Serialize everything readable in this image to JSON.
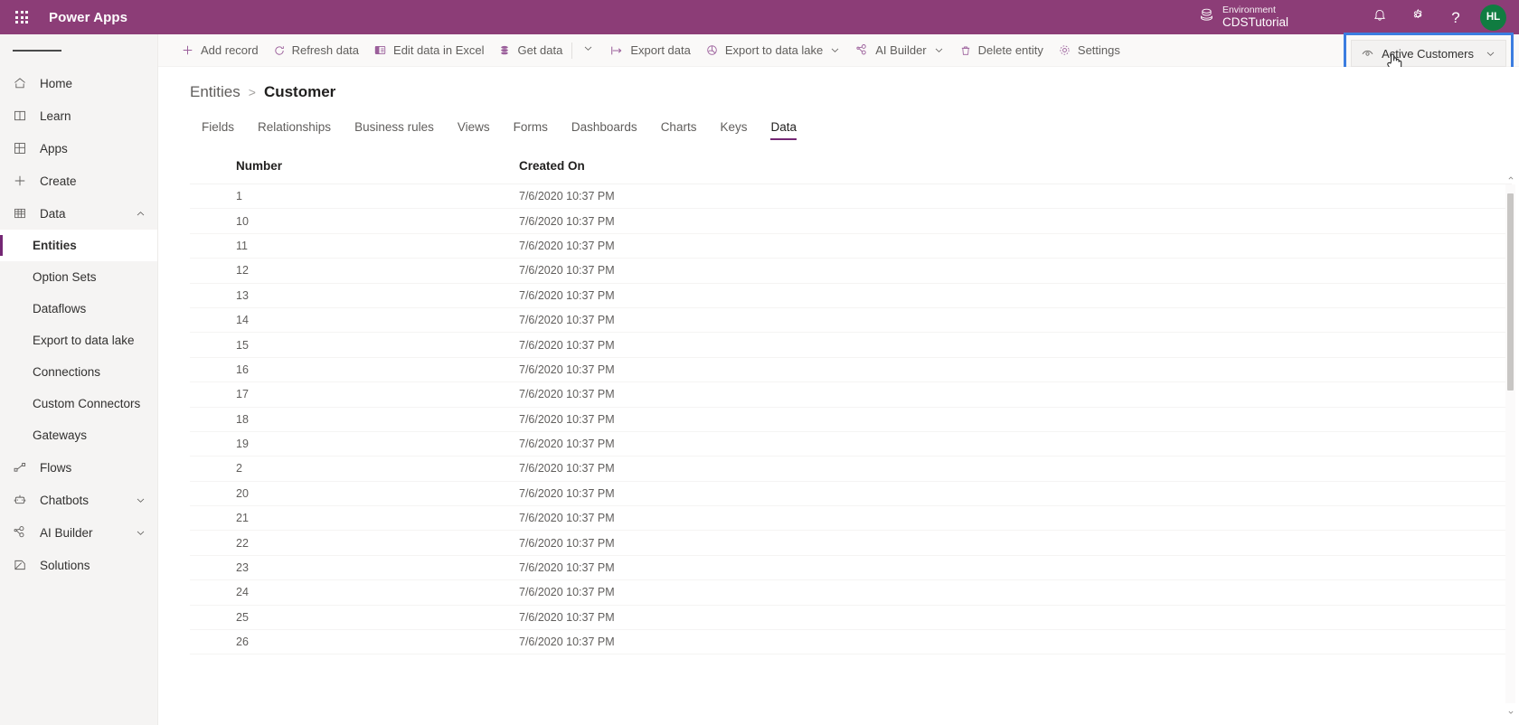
{
  "suitebar": {
    "waffle_label": "App launcher",
    "brand": "Power Apps",
    "environment_label": "Environment",
    "environment_name": "CDSTutorial",
    "notifications_label": "Notifications",
    "settings_label": "Settings",
    "help_label": "?",
    "avatar_initials": "HL",
    "avatar_color": "#107C41",
    "brand_color": "#8C3D77"
  },
  "sidebar": {
    "items": [
      {
        "label": "Home",
        "icon": "home-icon",
        "type": "top"
      },
      {
        "label": "Learn",
        "icon": "book-icon",
        "type": "top"
      },
      {
        "label": "Apps",
        "icon": "apps-grid-icon",
        "type": "top"
      },
      {
        "label": "Create",
        "icon": "plus-icon",
        "type": "top"
      },
      {
        "label": "Data",
        "icon": "table-icon",
        "type": "top",
        "expanded": true,
        "chevron": "chevron-up-icon"
      },
      {
        "label": "Entities",
        "type": "sub",
        "selected": true
      },
      {
        "label": "Option Sets",
        "type": "sub"
      },
      {
        "label": "Dataflows",
        "type": "sub"
      },
      {
        "label": "Export to data lake",
        "type": "sub"
      },
      {
        "label": "Connections",
        "type": "sub"
      },
      {
        "label": "Custom Connectors",
        "type": "sub"
      },
      {
        "label": "Gateways",
        "type": "sub"
      },
      {
        "label": "Flows",
        "icon": "flow-icon",
        "type": "top"
      },
      {
        "label": "Chatbots",
        "icon": "bot-icon",
        "type": "top",
        "chevron": "chevron-down-icon"
      },
      {
        "label": "AI Builder",
        "icon": "ai-builder-icon",
        "type": "top",
        "chevron": "chevron-down-icon"
      },
      {
        "label": "Solutions",
        "icon": "solutions-icon",
        "type": "top"
      }
    ]
  },
  "commandbar": {
    "items": [
      {
        "label": "Add record",
        "icon": "plus-icon"
      },
      {
        "label": "Refresh data",
        "icon": "refresh-icon"
      },
      {
        "label": "Edit data in Excel",
        "icon": "excel-icon"
      },
      {
        "label": "Get data",
        "icon": "database-icon"
      },
      {
        "label": "Export data",
        "icon": "export-arrow-icon"
      },
      {
        "label": "Export to data lake",
        "icon": "data-lake-icon",
        "chevron": "chevron-down-icon"
      },
      {
        "label": "AI Builder",
        "icon": "ai-builder-icon",
        "chevron": "chevron-down-icon"
      },
      {
        "label": "Delete entity",
        "icon": "trash-icon"
      },
      {
        "label": "Settings",
        "icon": "gear-icon"
      }
    ],
    "get_data_caret": "chevron-down-icon",
    "view_selector": {
      "label": "Active Customers",
      "icon": "view-eye-icon",
      "chevron": "chevron-down-icon",
      "highlight_color": "#3B7DE0",
      "highlighted": true,
      "cursor": "pointing-hand-cursor"
    }
  },
  "breadcrumb": {
    "parent": "Entities",
    "separator": ">",
    "current": "Customer"
  },
  "tabs": [
    {
      "label": "Fields",
      "active": false
    },
    {
      "label": "Relationships",
      "active": false
    },
    {
      "label": "Business rules",
      "active": false
    },
    {
      "label": "Views",
      "active": false
    },
    {
      "label": "Forms",
      "active": false
    },
    {
      "label": "Dashboards",
      "active": false
    },
    {
      "label": "Charts",
      "active": false
    },
    {
      "label": "Keys",
      "active": false
    },
    {
      "label": "Data",
      "active": true
    }
  ],
  "grid": {
    "columns": [
      "Number",
      "Created On"
    ],
    "rows": [
      {
        "number": "1",
        "created_on": "7/6/2020 10:37 PM"
      },
      {
        "number": "10",
        "created_on": "7/6/2020 10:37 PM"
      },
      {
        "number": "11",
        "created_on": "7/6/2020 10:37 PM"
      },
      {
        "number": "12",
        "created_on": "7/6/2020 10:37 PM"
      },
      {
        "number": "13",
        "created_on": "7/6/2020 10:37 PM"
      },
      {
        "number": "14",
        "created_on": "7/6/2020 10:37 PM"
      },
      {
        "number": "15",
        "created_on": "7/6/2020 10:37 PM"
      },
      {
        "number": "16",
        "created_on": "7/6/2020 10:37 PM"
      },
      {
        "number": "17",
        "created_on": "7/6/2020 10:37 PM"
      },
      {
        "number": "18",
        "created_on": "7/6/2020 10:37 PM"
      },
      {
        "number": "19",
        "created_on": "7/6/2020 10:37 PM"
      },
      {
        "number": "2",
        "created_on": "7/6/2020 10:37 PM"
      },
      {
        "number": "20",
        "created_on": "7/6/2020 10:37 PM"
      },
      {
        "number": "21",
        "created_on": "7/6/2020 10:37 PM"
      },
      {
        "number": "22",
        "created_on": "7/6/2020 10:37 PM"
      },
      {
        "number": "23",
        "created_on": "7/6/2020 10:37 PM"
      },
      {
        "number": "24",
        "created_on": "7/6/2020 10:37 PM"
      },
      {
        "number": "25",
        "created_on": "7/6/2020 10:37 PM"
      },
      {
        "number": "26",
        "created_on": "7/6/2020 10:37 PM"
      }
    ]
  }
}
